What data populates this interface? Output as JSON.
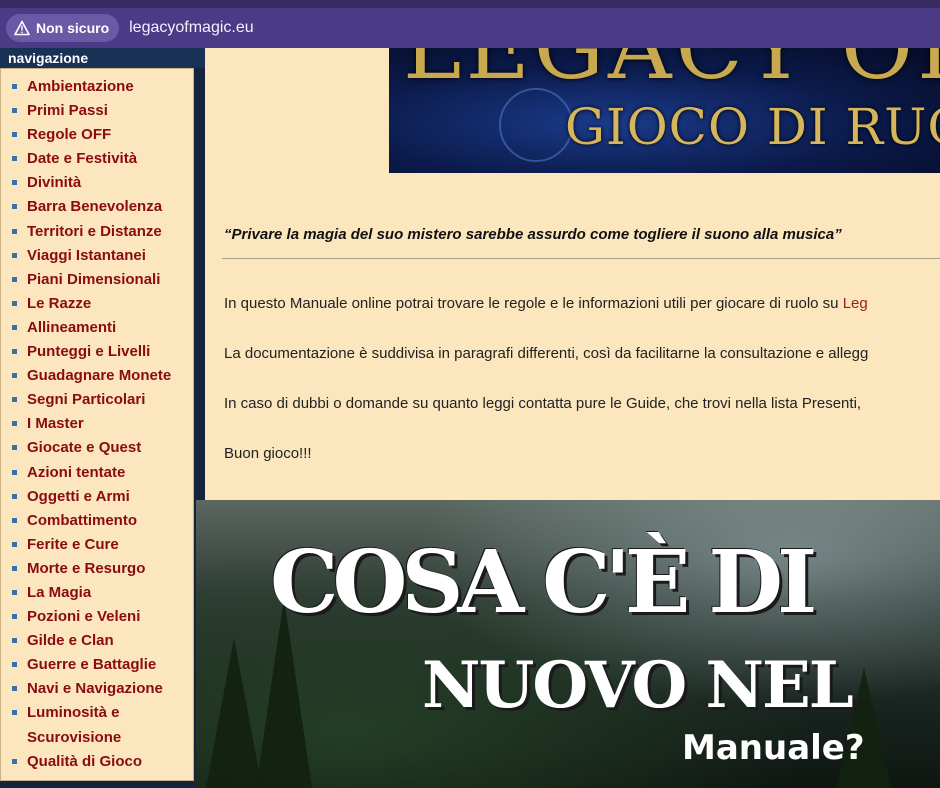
{
  "browser": {
    "security_label": "Non sicuro",
    "url": "legacyofmagic.eu"
  },
  "sidebar": {
    "heading": "navigazione",
    "items": [
      "Ambientazione",
      "Primi Passi",
      "Regole OFF",
      "Date e Festività",
      "Divinità",
      "Barra Benevolenza",
      "Territori e Distanze",
      "Viaggi Istantanei",
      "Piani Dimensionali",
      "Le Razze",
      "Allineamenti",
      "Punteggi e Livelli",
      "Guadagnare Monete",
      "Segni Particolari",
      "I Master",
      "Giocate e Quest",
      "Azioni tentate",
      "Oggetti e Armi",
      "Combattimento",
      "Ferite e Cure",
      "Morte e Resurgo",
      "La Magia",
      "Pozioni e Veleni",
      "Gilde e Clan",
      "Guerre e Battaglie",
      "Navi e Navigazione",
      "Luminosità e",
      "Scurovisione",
      "Qualità di Gioco"
    ]
  },
  "banner": {
    "title": "LEGACY OF M",
    "subtitle": "GIOCO DI RUOLO"
  },
  "main": {
    "quote": "“Privare la magia del suo mistero sarebbe assurdo come togliere il suono alla musica”",
    "para1_text": "In questo Manuale online potrai trovare le regole e le informazioni utili per giocare di ruolo su ",
    "para1_link": "Leg",
    "para2": "La documentazione è suddivisa in paragrafi differenti, così da facilitarne la consultazione e allegg",
    "para3": "In caso di dubbi o domande su quanto leggi contatta pure le Guide, che trovi nella lista Presenti,",
    "para4": "Buon gioco!!!"
  },
  "promo": {
    "line1": "COSA C'È DI",
    "line2": "NUOVO NEL",
    "line3": "Manuale?"
  }
}
